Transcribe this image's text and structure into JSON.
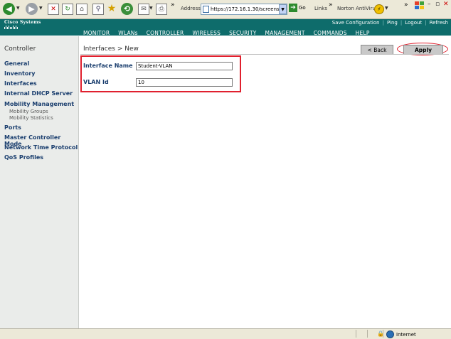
{
  "browser": {
    "address_label": "Address",
    "address_url": "https://172.16.1.30/screens/fra",
    "go_label": "Go",
    "links_label": "Links",
    "norton_label": "Norton AntiVirus",
    "extra_chevron": "»"
  },
  "header": {
    "logo_text": "Cisco Systems",
    "top_links": [
      "Save Configuration",
      "Ping",
      "Logout",
      "Refresh"
    ],
    "nav": [
      {
        "label": "MONITOR",
        "active": false
      },
      {
        "label": "WLANs",
        "active": false
      },
      {
        "label": "CONTROLLER",
        "active": true
      },
      {
        "label": "WIRELESS",
        "active": false
      },
      {
        "label": "SECURITY",
        "active": false
      },
      {
        "label": "MANAGEMENT",
        "active": false
      },
      {
        "label": "COMMANDS",
        "active": false
      },
      {
        "label": "HELP",
        "active": false
      }
    ]
  },
  "sidebar": {
    "title": "Controller",
    "items": [
      {
        "label": "General"
      },
      {
        "label": "Inventory"
      },
      {
        "label": "Interfaces"
      },
      {
        "label": "Internal DHCP Server"
      },
      {
        "label": "Mobility Management"
      },
      {
        "label": "Mobility Groups"
      },
      {
        "label": "Mobility Statistics"
      },
      {
        "label": "Ports"
      },
      {
        "label": "Master Controller Mode"
      },
      {
        "label": "Network Time Protocol"
      },
      {
        "label": "QoS Profiles"
      }
    ]
  },
  "main": {
    "page_title": "Interfaces > New",
    "back_label": "< Back",
    "apply_label": "Apply",
    "form": {
      "interface_name_label": "Interface Name",
      "interface_name_value": "Student-VLAN",
      "vlan_id_label": "VLAN Id",
      "vlan_id_value": "10"
    }
  },
  "statusbar": {
    "zone_label": "Internet"
  },
  "colors": {
    "brand_teal": "#0e6c6b",
    "highlight_red": "#e0202e",
    "sidebar_link": "#1a3e6e"
  }
}
